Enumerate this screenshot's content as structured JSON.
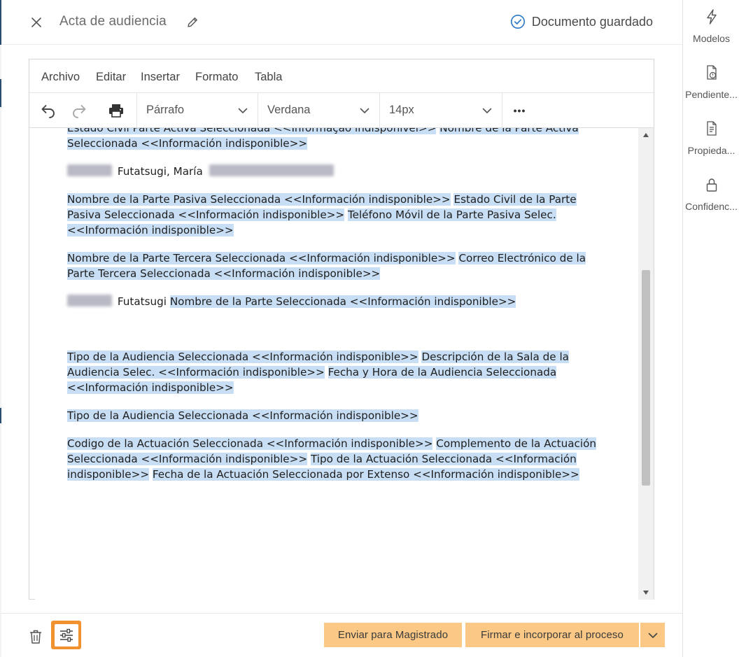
{
  "header": {
    "title": "Acta de audiencia",
    "saved_status": "Documento guardado",
    "accent_color": "#2b78c5"
  },
  "sidebar": {
    "items": [
      {
        "label": "Modelos",
        "icon": "lightning-icon"
      },
      {
        "label": "Pendiente...",
        "icon": "document-alert-icon"
      },
      {
        "label": "Propieda...",
        "icon": "document-list-icon"
      },
      {
        "label": "Confidenc...",
        "icon": "lock-icon"
      }
    ]
  },
  "menu": [
    "Archivo",
    "Editar",
    "Insertar",
    "Formato",
    "Tabla"
  ],
  "toolbar": {
    "block_format": "Párrafo",
    "font_family": "Verdana",
    "font_size": "14px",
    "more_label": "•••"
  },
  "document": {
    "p1": [
      "Estado Civil Parte Activa Seleccionada <<Informação indisponível>>",
      "Nombre de la Parte Activa Seleccionada <<Información indisponible>>"
    ],
    "p2": "Futatsugi, María",
    "p3": [
      "Nombre de la Parte Pasiva Seleccionada <<Información indisponible>>",
      "Estado Civil de la Parte Pasiva Seleccionada <<Información indisponible>>",
      "Teléfono Móvil de la Parte Pasiva Selec. <<Información indisponible>>"
    ],
    "p4": [
      "Nombre de la Parte Tercera Seleccionada <<Información indisponible>>",
      "Correo Electrónico de la Parte Tercera Seleccionada <<Información indisponible>>"
    ],
    "p5": [
      "Futatsugi",
      "Nombre de la Parte Seleccionada <<Información indisponible>>"
    ],
    "p6": [
      "Tipo de la Audiencia Seleccionada <<Información indisponible>>",
      "Descripción de la Sala de la Audiencia Selec. <<Información indisponible>>",
      "Fecha y Hora de la Audiencia Seleccionada <<Información indisponible>>"
    ],
    "p7": "Tipo de la Audiencia Seleccionada <<Información indisponible>>",
    "p8": [
      "Codigo de la Actuación Seleccionada <<Información indisponible>>",
      "Complemento de la Actuación Seleccionada <<Información indisponible>>",
      "Tipo de la Actuación Seleccionada <<Información indisponible>>",
      "Fecha de la Actuación Seleccionada por Extenso <<Información indisponible>>"
    ],
    "highlight_color": "#c8def4"
  },
  "footer": {
    "send_label": "Enviar para Magistrado",
    "sign_label": "Firmar e incorporar al proceso",
    "button_color": "#fbc885",
    "settings_color": "#f0922f"
  }
}
